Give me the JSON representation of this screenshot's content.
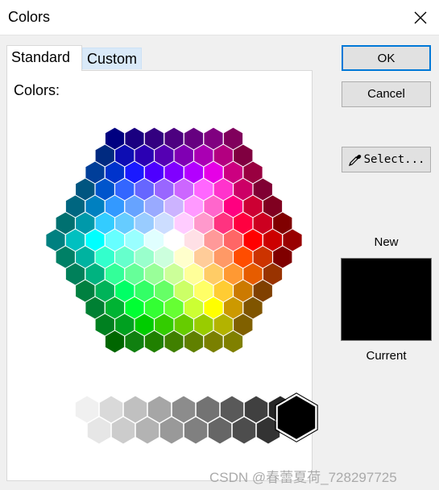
{
  "window": {
    "title": "Colors",
    "close_icon": "close-icon"
  },
  "tabs": [
    {
      "label": "Standard",
      "selected": true
    },
    {
      "label": "Custom",
      "selected": false
    }
  ],
  "standard": {
    "colors_label": "Colors:",
    "hexagon_rows": [
      [
        "#000080",
        "#1a0080",
        "#330080",
        "#4d0080",
        "#660080",
        "#800080",
        "#80005c"
      ],
      [
        "#002a80",
        "#0d0db3",
        "#2b00b3",
        "#5500b3",
        "#8000b3",
        "#aa00b3",
        "#b30080",
        "#800040"
      ],
      [
        "#003e99",
        "#0033cc",
        "#1a1aff",
        "#4d00ff",
        "#8000ff",
        "#b300ff",
        "#e600e6",
        "#cc0080",
        "#990040"
      ],
      [
        "#005580",
        "#0055cc",
        "#3366ff",
        "#6666ff",
        "#9966ff",
        "#cc66ff",
        "#ff66ff",
        "#ff33cc",
        "#cc0066",
        "#800033"
      ],
      [
        "#006680",
        "#0080c0",
        "#3399ff",
        "#66a3ff",
        "#99aaff",
        "#ccb3ff",
        "#ff99ff",
        "#ff66cc",
        "#ff0080",
        "#cc0033",
        "#800020"
      ],
      [
        "#007070",
        "#0099aa",
        "#33ccff",
        "#66ccff",
        "#99ccff",
        "#ccddff",
        "#ffccff",
        "#ff99cc",
        "#ff3380",
        "#ff0040",
        "#cc0020",
        "#800000"
      ],
      [
        "#008080",
        "#00c0c0",
        "#00ffff",
        "#66ffff",
        "#99ffff",
        "#e0ffff",
        "#ffffff",
        "#ffe0e6",
        "#ff9999",
        "#ff6666",
        "#ff0000",
        "#cc0000",
        "#990000"
      ],
      [
        "#008066",
        "#00b3a0",
        "#33ffcc",
        "#66ffcc",
        "#99ffcc",
        "#ccffdd",
        "#ffffcc",
        "#ffcc99",
        "#ff9966",
        "#ff4d00",
        "#cc3300",
        "#800000"
      ],
      [
        "#00805a",
        "#00b380",
        "#33ff99",
        "#66ff99",
        "#99ff99",
        "#ccff99",
        "#ffff99",
        "#ffcc66",
        "#ff9933",
        "#e65c00",
        "#993300"
      ],
      [
        "#008040",
        "#00b359",
        "#00ff66",
        "#33ff66",
        "#66ff66",
        "#ccff66",
        "#ffff66",
        "#ffcc33",
        "#cc7a00",
        "#804000"
      ],
      [
        "#008033",
        "#00b333",
        "#00ff33",
        "#33ff33",
        "#66ff33",
        "#ccff33",
        "#ffff00",
        "#cc9900",
        "#805500"
      ],
      [
        "#008020",
        "#00a020",
        "#00cc00",
        "#33cc00",
        "#66cc00",
        "#99cc00",
        "#b3b300",
        "#806000"
      ],
      [
        "#006600",
        "#108010",
        "#208000",
        "#408000",
        "#608000",
        "#7a8000",
        "#808000"
      ]
    ],
    "gray_row_1": [
      "#f0f0f0",
      "#d9d9d9",
      "#c0c0c0",
      "#a6a6a6",
      "#8c8c8c",
      "#737373",
      "#595959",
      "#404040",
      "#262626"
    ],
    "gray_row_2": [
      "#e6e6e6",
      "#cccccc",
      "#b3b3b3",
      "#999999",
      "#808080",
      "#666666",
      "#4d4d4d",
      "#333333"
    ],
    "black_swatch": "#000000"
  },
  "buttons": {
    "ok": "OK",
    "cancel": "Cancel",
    "select": "Select...",
    "select_icon": "eyedropper-icon"
  },
  "preview": {
    "new_label": "New",
    "current_label": "Current",
    "color": "#000000"
  },
  "watermark": "CSDN @春蕾夏荷_728297725"
}
